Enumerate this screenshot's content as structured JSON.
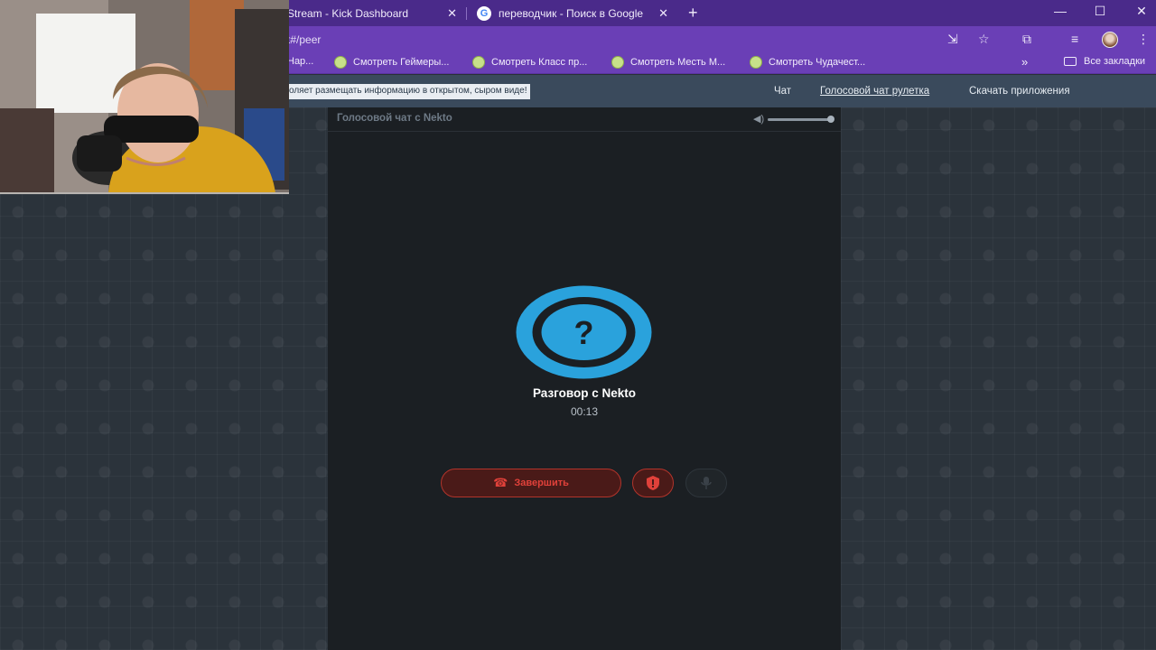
{
  "browser": {
    "tabs": [
      {
        "title": "Stream - Kick Dashboard",
        "active": true
      },
      {
        "title": "переводчик - Поиск в Google",
        "active": false
      }
    ],
    "new_tab_label": "+",
    "url": "t#/peer",
    "accent_color": "#6a3fb6",
    "bookmarks": [
      {
        "label": "Нар..."
      },
      {
        "label": "Смотреть Геймеры..."
      },
      {
        "label": "Смотреть Класс пр..."
      },
      {
        "label": "Смотреть Месть М..."
      },
      {
        "label": "Смотреть Чудачест..."
      }
    ],
    "bookmarks_more": "»",
    "all_bookmarks_label": "Все закладки"
  },
  "site": {
    "notice_text": "оляет размещать информацию в открытом, сыром виде!",
    "nav": [
      {
        "label": "Чат",
        "active": false
      },
      {
        "label": "Голосовой чат рулетка",
        "active": true
      },
      {
        "label": "Скачать приложения",
        "active": false
      }
    ]
  },
  "call": {
    "panel_title": "Голосовой чат с Nekto",
    "volume_percent": 100,
    "peer_name": "Разговор с Nekto",
    "timer": "00:13",
    "end_label": "Завершить",
    "avatar_symbol": "?",
    "avatar_color": "#2aa2dc",
    "end_color": "#e0413a"
  }
}
